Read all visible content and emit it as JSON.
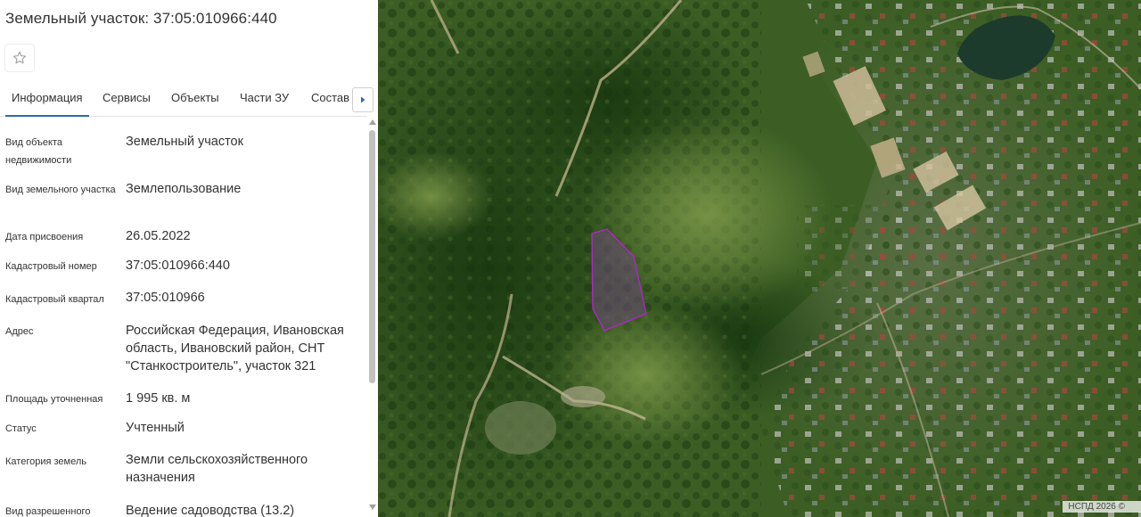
{
  "header": {
    "title": "Земельный участок: 37:05:010966:440"
  },
  "tabs": [
    {
      "label": "Информация",
      "active": true
    },
    {
      "label": "Сервисы"
    },
    {
      "label": "Объекты"
    },
    {
      "label": "Части ЗУ"
    },
    {
      "label": "Состав"
    }
  ],
  "info": [
    {
      "label": "Вид объекта недвижимости",
      "value": "Земельный участок"
    },
    {
      "label": "Вид земельного участка",
      "value": "Землепользование"
    },
    {
      "label": "Дата присвоения",
      "value": "26.05.2022"
    },
    {
      "label": "Кадастровый номер",
      "value": "37:05:010966:440"
    },
    {
      "label": "Кадастровый квартал",
      "value": "37:05:010966"
    },
    {
      "label": "Адрес",
      "value": "Российская Федерация, Ивановская область, Ивановский район, СНТ \"Станкостроитель\", участок 321"
    },
    {
      "label": "Площадь уточненная",
      "value": "1 995 кв. м"
    },
    {
      "label": "Статус",
      "value": "Учтенный"
    },
    {
      "label": "Категория земель",
      "value": "Земли сельскохозяйственного назначения"
    },
    {
      "label": "Вид разрешенного",
      "value": "Ведение садоводства (13.2)"
    }
  ],
  "map": {
    "copyright": "НСПД 2026 ©",
    "parcel_color": "#b025c8"
  },
  "icons": {
    "favorite": "star-outline-icon",
    "tabs_next": "chevron-right-icon"
  }
}
